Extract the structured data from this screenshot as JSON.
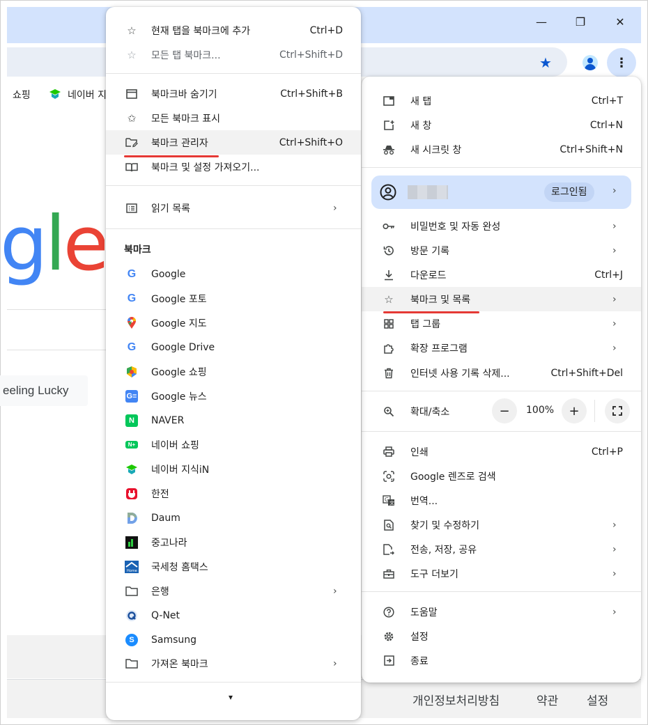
{
  "window": {
    "minimize": "—",
    "restore": "❐",
    "close": "✕"
  },
  "bookmarks_bar": {
    "items": [
      "쇼핑",
      "네이버 지"
    ]
  },
  "page": {
    "logo_fragment": "gle",
    "lucky_button": "eeling Lucky",
    "footer": [
      "개인정보처리방침",
      "약관",
      "설정"
    ]
  },
  "bookmarks_menu": {
    "top": [
      {
        "label": "현재 탭을 북마크에 추가",
        "shortcut": "Ctrl+D",
        "icon": "star-icon"
      },
      {
        "label": "모든 탭 북마크...",
        "shortcut": "Ctrl+Shift+D",
        "icon": "star-plus-icon",
        "disabled": true
      }
    ],
    "middle": [
      {
        "label": "북마크바 숨기기",
        "shortcut": "Ctrl+Shift+B",
        "icon": "window-icon"
      },
      {
        "label": "모든 북마크 표시",
        "shortcut": "",
        "icon": "stars-icon"
      },
      {
        "label": "북마크 관리자",
        "shortcut": "Ctrl+Shift+O",
        "icon": "folder-edit-icon"
      },
      {
        "label": "북마크 및 설정 가져오기...",
        "shortcut": "",
        "icon": "book-icon"
      }
    ],
    "reading_list": "읽기 목록",
    "section_header": "북마크",
    "bookmarks": [
      "Google",
      "Google 포토",
      "Google 지도",
      "Google Drive",
      "Google 쇼핑",
      "Google 뉴스",
      "NAVER",
      "네이버 쇼핑",
      "네이버 지식iN",
      "한전",
      "Daum",
      "중고나라",
      "국세청 홈택스",
      "은행",
      "Q-Net",
      "Samsung",
      "가져온 북마크"
    ],
    "more_arrow": "▾"
  },
  "main_menu": {
    "group1": [
      {
        "label": "새 탭",
        "shortcut": "Ctrl+T"
      },
      {
        "label": "새 창",
        "shortcut": "Ctrl+N"
      },
      {
        "label": "새 시크릿 창",
        "shortcut": "Ctrl+Shift+N"
      }
    ],
    "profile": {
      "login_label": "로그인됨"
    },
    "group2": [
      {
        "label": "비밀번호 및 자동 완성",
        "shortcut": ""
      },
      {
        "label": "방문 기록",
        "shortcut": ""
      },
      {
        "label": "다운로드",
        "shortcut": "Ctrl+J"
      },
      {
        "label": "북마크 및 목록",
        "shortcut": ""
      },
      {
        "label": "탭 그룹",
        "shortcut": ""
      },
      {
        "label": "확장 프로그램",
        "shortcut": ""
      },
      {
        "label": "인터넷 사용 기록 삭제...",
        "shortcut": "Ctrl+Shift+Del"
      }
    ],
    "zoom": {
      "label": "확대/축소",
      "value": "100%",
      "minus": "−",
      "plus": "+"
    },
    "group3": [
      {
        "label": "인쇄",
        "shortcut": "Ctrl+P"
      },
      {
        "label": "Google 렌즈로 검색",
        "shortcut": ""
      },
      {
        "label": "번역...",
        "shortcut": ""
      },
      {
        "label": "찾기 및 수정하기",
        "shortcut": ""
      },
      {
        "label": "전송, 저장, 공유",
        "shortcut": ""
      },
      {
        "label": "도구 더보기",
        "shortcut": ""
      }
    ],
    "group4": [
      {
        "label": "도움말",
        "shortcut": ""
      },
      {
        "label": "설정",
        "shortcut": ""
      },
      {
        "label": "종료",
        "shortcut": ""
      }
    ]
  },
  "colors": {
    "accent": "#0b57d0",
    "chrome_frame": "#d3e3fd",
    "highlight_underline": "#e53935"
  }
}
